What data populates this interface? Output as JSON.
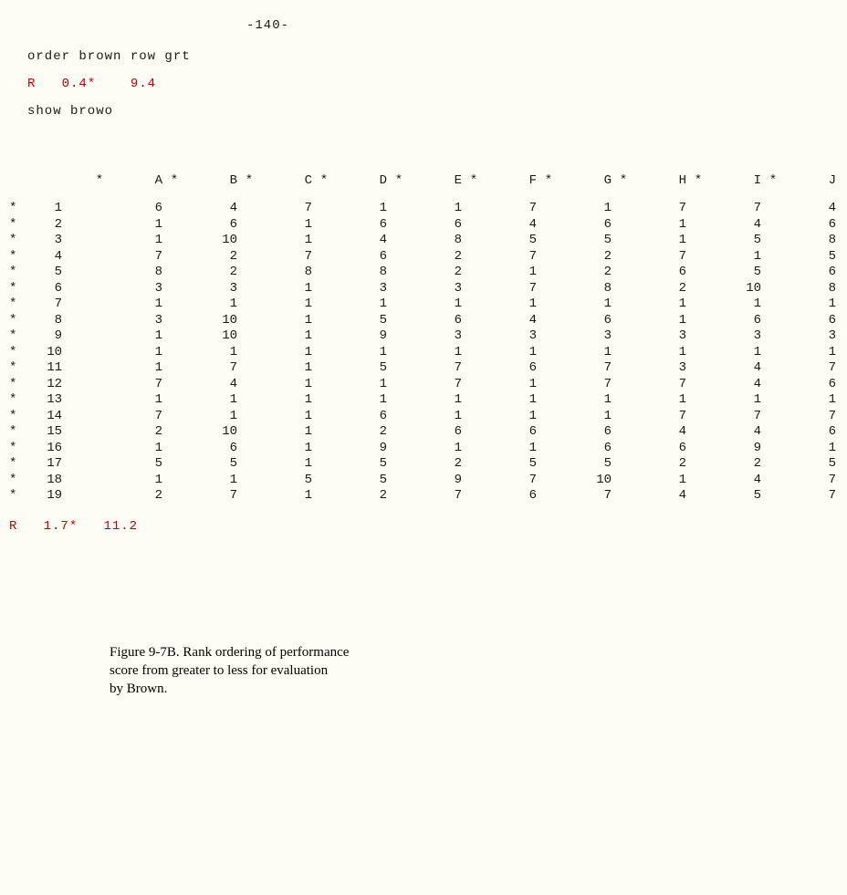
{
  "page_number": "-140-",
  "cmd1": "order brown row grt",
  "stat1_prefix": "R",
  "stat1_a": "0.4*",
  "stat1_b": "9.4",
  "cmd2": "show browo",
  "stat2_prefix": "R",
  "stat2_a": "1.7*",
  "stat2_b": "11.2",
  "star": "*",
  "columns": [
    "A",
    "B",
    "C",
    "D",
    "E",
    "F",
    "G",
    "H",
    "I",
    "J"
  ],
  "rows": [
    {
      "n": "1",
      "v": [
        "6",
        "4",
        "7",
        "1",
        "1",
        "7",
        "1",
        "7",
        "7",
        "4"
      ]
    },
    {
      "n": "2",
      "v": [
        "1",
        "6",
        "1",
        "6",
        "6",
        "4",
        "6",
        "1",
        "4",
        "6"
      ]
    },
    {
      "n": "3",
      "v": [
        "1",
        "10",
        "1",
        "4",
        "8",
        "5",
        "5",
        "1",
        "5",
        "8"
      ]
    },
    {
      "n": "4",
      "v": [
        "7",
        "2",
        "7",
        "6",
        "2",
        "7",
        "2",
        "7",
        "1",
        "5"
      ]
    },
    {
      "n": "5",
      "v": [
        "8",
        "2",
        "8",
        "8",
        "2",
        "1",
        "2",
        "6",
        "5",
        "6"
      ]
    },
    {
      "n": "6",
      "v": [
        "3",
        "3",
        "1",
        "3",
        "3",
        "7",
        "8",
        "2",
        "10",
        "8"
      ]
    },
    {
      "n": "7",
      "v": [
        "1",
        "1",
        "1",
        "1",
        "1",
        "1",
        "1",
        "1",
        "1",
        "1"
      ]
    },
    {
      "n": "8",
      "v": [
        "3",
        "10",
        "1",
        "5",
        "6",
        "4",
        "6",
        "1",
        "6",
        "6"
      ]
    },
    {
      "n": "9",
      "v": [
        "1",
        "10",
        "1",
        "9",
        "3",
        "3",
        "3",
        "3",
        "3",
        "3"
      ]
    },
    {
      "n": "10",
      "v": [
        "1",
        "1",
        "1",
        "1",
        "1",
        "1",
        "1",
        "1",
        "1",
        "1"
      ]
    },
    {
      "n": "11",
      "v": [
        "1",
        "7",
        "1",
        "5",
        "7",
        "6",
        "7",
        "3",
        "4",
        "7"
      ]
    },
    {
      "n": "12",
      "v": [
        "7",
        "4",
        "1",
        "1",
        "7",
        "1",
        "7",
        "7",
        "4",
        "6"
      ]
    },
    {
      "n": "13",
      "v": [
        "1",
        "1",
        "1",
        "1",
        "1",
        "1",
        "1",
        "1",
        "1",
        "1"
      ]
    },
    {
      "n": "14",
      "v": [
        "7",
        "1",
        "1",
        "6",
        "1",
        "1",
        "1",
        "7",
        "7",
        "7"
      ]
    },
    {
      "n": "15",
      "v": [
        "2",
        "10",
        "1",
        "2",
        "6",
        "6",
        "6",
        "4",
        "4",
        "6"
      ]
    },
    {
      "n": "16",
      "v": [
        "1",
        "6",
        "1",
        "9",
        "1",
        "1",
        "6",
        "6",
        "9",
        "1"
      ]
    },
    {
      "n": "17",
      "v": [
        "5",
        "5",
        "1",
        "5",
        "2",
        "5",
        "5",
        "2",
        "2",
        "5"
      ]
    },
    {
      "n": "18",
      "v": [
        "1",
        "1",
        "5",
        "5",
        "9",
        "7",
        "10",
        "1",
        "4",
        "7"
      ]
    },
    {
      "n": "19",
      "v": [
        "2",
        "7",
        "1",
        "2",
        "7",
        "6",
        "7",
        "4",
        "5",
        "7"
      ]
    }
  ],
  "caption_line1": "Figure 9-7B.  Rank ordering of performance",
  "caption_line2": "score from greater to less for evaluation",
  "caption_line3": "by Brown."
}
